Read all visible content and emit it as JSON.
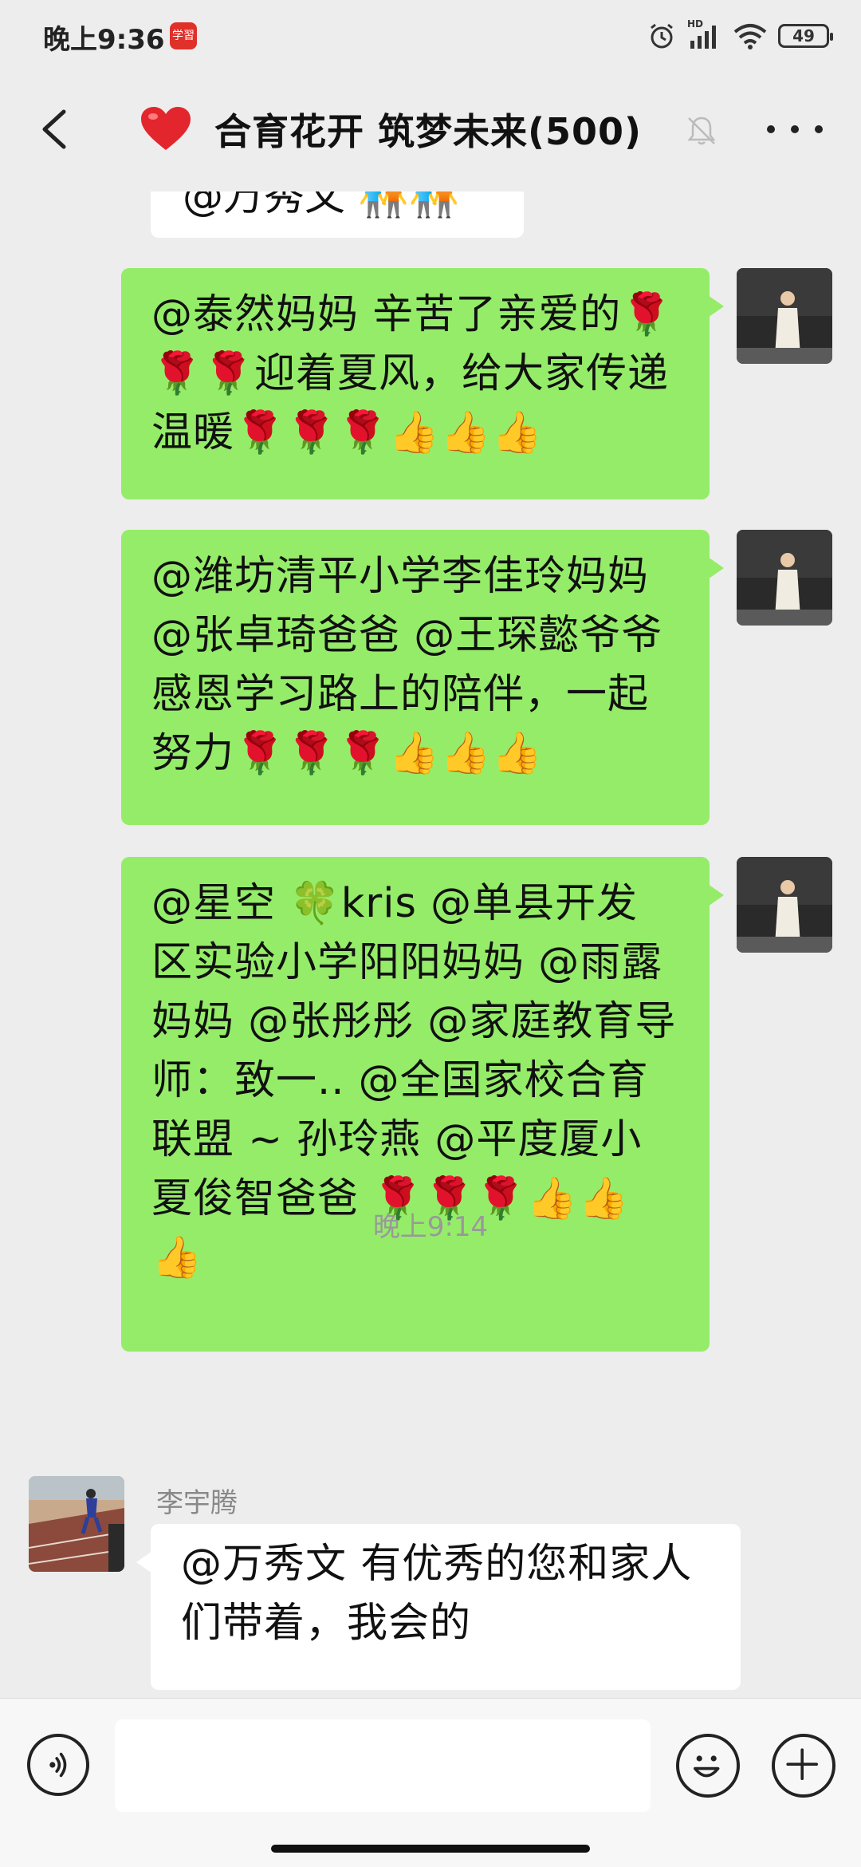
{
  "status_bar": {
    "time": "晚上9:36",
    "app_icon_label": "学習",
    "network_label": "HD",
    "battery": "49"
  },
  "header": {
    "title": "合育花开 筑梦未来(500)",
    "icons": [
      "back-arrow-icon",
      "heart-icon",
      "mute-bell-icon",
      "more-icon"
    ]
  },
  "messages": {
    "partial": {
      "text": "@万秀文 🧑‍🤝‍🧑🧑‍🤝‍🧑"
    },
    "msg1": {
      "text": "@泰然妈妈 辛苦了亲爱的🌹🌹🌹迎着夏风，给大家传递温暖🌹🌹🌹👍👍👍"
    },
    "msg2": {
      "text": "@潍坊清平小学李佳玲妈妈 @张卓琦爸爸 @王琛懿爷爷 感恩学习路上的陪伴，一起努力🌹🌹🌹👍👍👍"
    },
    "msg3": {
      "text": "@星空 🍀kris @单县开发区实验小学阳阳妈妈 @雨露妈妈 @张彤彤 @家庭教育导师：致一.. @全国家校合育联盟 ~ 孙玲燕 @平度厦小夏俊智爸爸 🌹🌹🌹👍👍👍"
    },
    "timestamp": "晚上9:14",
    "msg4": {
      "sender": "李宇腾",
      "text": "@万秀文 有优秀的您和家人们带着，我会的"
    }
  },
  "input_bar": {
    "placeholder": "",
    "icons": [
      "voice-icon",
      "emoji-icon",
      "plus-icon"
    ]
  }
}
